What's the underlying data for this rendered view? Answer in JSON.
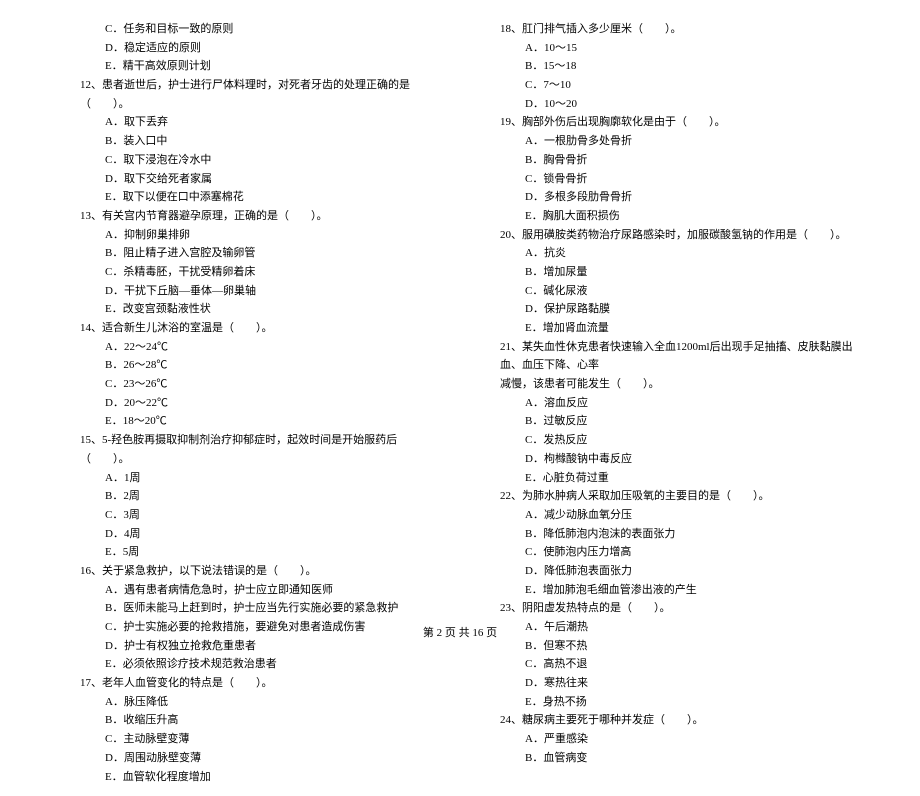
{
  "left_column": {
    "q11_options_cont": [
      "C．任务和目标一致的原则",
      "D．稳定适应的原则",
      "E．精干高效原则计划"
    ],
    "q12": {
      "stem": "12、患者逝世后，护士进行尸体料理时，对死者牙齿的处理正确的是（　　）。",
      "options": [
        "A．取下丢弃",
        "B．装入口中",
        "C．取下浸泡在冷水中",
        "D．取下交给死者家属",
        "E．取下以便在口中添塞棉花"
      ]
    },
    "q13": {
      "stem": "13、有关宫内节育器避孕原理，正确的是（　　）。",
      "options": [
        "A．抑制卵巢排卵",
        "B．阻止精子进入宫腔及输卵管",
        "C．杀精毒胚，干扰受精卵着床",
        "D．干扰下丘脑—垂体—卵巢轴",
        "E．改变宫颈黏液性状"
      ]
    },
    "q14": {
      "stem": "14、适合新生儿沐浴的室温是（　　）。",
      "options": [
        "A．22～24℃",
        "B．26～28℃",
        "C．23～26℃",
        "D．20～22℃",
        "E．18～20℃"
      ]
    },
    "q15": {
      "stem": "15、5-羟色胺再摄取抑制剂治疗抑郁症时，起效时间是开始服药后（　　）。",
      "options": [
        "A．1周",
        "B．2周",
        "C．3周",
        "D．4周",
        "E．5周"
      ]
    },
    "q16": {
      "stem": "16、关于紧急救护，以下说法错误的是（　　）。",
      "options": [
        "A．遇有患者病情危急时，护士应立即通知医师",
        "B．医师未能马上赶到时，护士应当先行实施必要的紧急救护",
        "C．护士实施必要的抢救措施，要避免对患者造成伤害",
        "D．护士有权独立抢救危重患者",
        "E．必须依照诊疗技术规范救治患者"
      ]
    },
    "q17": {
      "stem": "17、老年人血管变化的特点是（　　）。",
      "options": [
        "A．脉压降低",
        "B．收缩压升高",
        "C．主动脉壁变薄",
        "D．周围动脉壁变薄",
        "E．血管软化程度增加"
      ]
    }
  },
  "right_column": {
    "q18": {
      "stem": "18、肛门排气插入多少厘米（　　）。",
      "options": [
        "A．10～15",
        "B．15～18",
        "C．7～10",
        "D．10～20"
      ]
    },
    "q19": {
      "stem": "19、胸部外伤后出现胸廓软化是由于（　　）。",
      "options": [
        "A．一根肋骨多处骨折",
        "B．胸骨骨折",
        "C．锁骨骨折",
        "D．多根多段肋骨骨折",
        "E．胸肌大面积损伤"
      ]
    },
    "q20": {
      "stem": "20、服用磺胺类药物治疗尿路感染时，加服碳酸氢钠的作用是（　　）。",
      "options": [
        "A．抗炎",
        "B．增加尿量",
        "C．碱化尿液",
        "D．保护尿路黏膜",
        "E．增加肾血流量"
      ]
    },
    "q21": {
      "stem": "21、某失血性休克患者快速输入全血1200ml后出现手足抽搐、皮肤黏膜出血、血压下降、心率",
      "stem_cont": "减慢，该患者可能发生（　　）。",
      "options": [
        "A．溶血反应",
        "B．过敏反应",
        "C．发热反应",
        "D．枸橼酸钠中毒反应",
        "E．心脏负荷过重"
      ]
    },
    "q22": {
      "stem": "22、为肺水肿病人采取加压吸氧的主要目的是（　　）。",
      "options": [
        "A．减少动脉血氧分压",
        "B．降低肺泡内泡沫的表面张力",
        "C．使肺泡内压力增高",
        "D．降低肺泡表面张力",
        "E．增加肺泡毛细血管渗出液的产生"
      ]
    },
    "q23": {
      "stem": "23、阴阳虚发热特点的是（　　）。",
      "options": [
        "A．午后潮热",
        "B．但寒不热",
        "C．高热不退",
        "D．寒热往来",
        "E．身热不扬"
      ]
    },
    "q24": {
      "stem": "24、糖尿病主要死于哪种并发症（　　）。",
      "options": [
        "A．严重感染",
        "B．血管病变"
      ]
    }
  },
  "footer": "第 2 页 共 16 页"
}
